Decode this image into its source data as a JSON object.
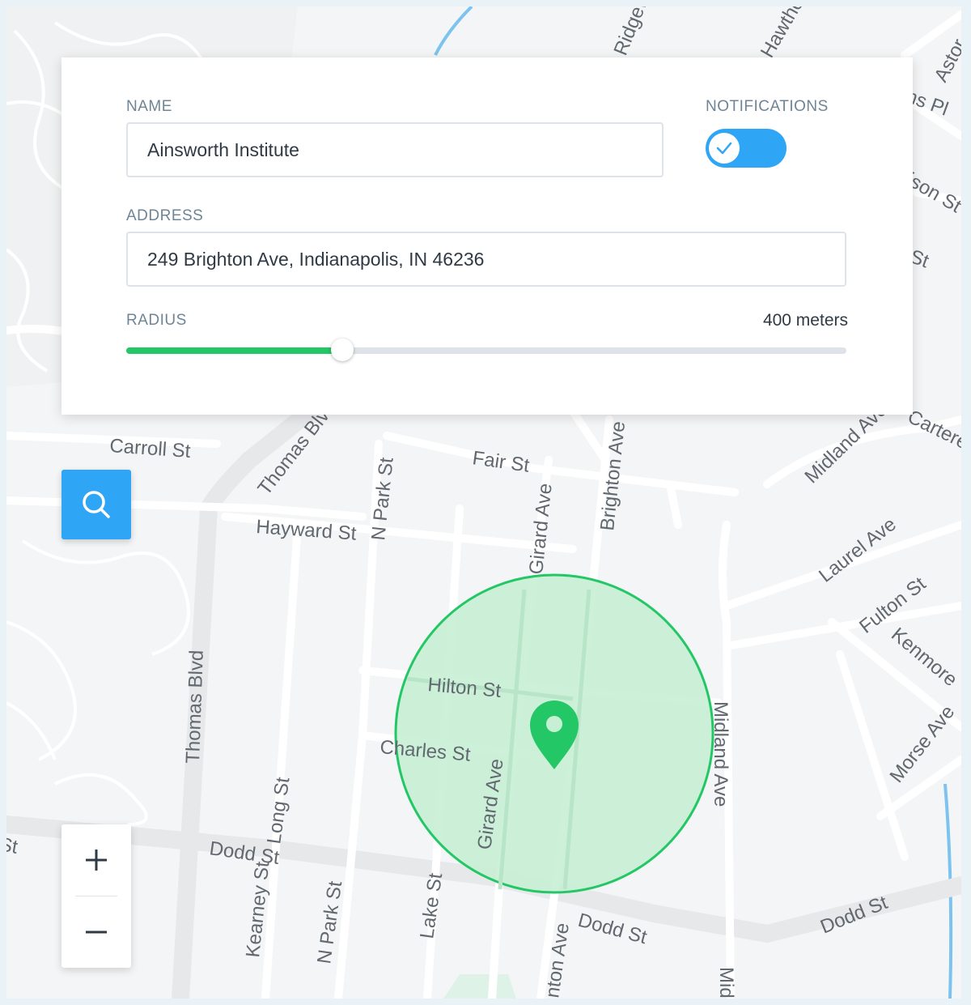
{
  "form": {
    "name_label": "NAME",
    "name_value": "Ainsworth Institute",
    "notifications_label": "NOTIFICATIONS",
    "notifications_on": true,
    "address_label": "ADDRESS",
    "address_value": "249 Brighton Ave, Indianapolis, IN 46236",
    "radius_label": "RADIUS",
    "radius_value": "400 meters",
    "radius_fraction": 0.3
  },
  "map": {
    "streets": {
      "ridgeway": "Ridgeway",
      "hawthorne": "Hawthorne",
      "astor": "Astor",
      "williams_pl": "Williams Pl",
      "madison_st": "Madison St",
      "st_fragment": "St",
      "carroll_st": "Carroll St",
      "thomas_blvd_upper": "Thomas Blvd",
      "n_park_st_upper": "N Park St",
      "fair_st": "Fair St",
      "girard_ave_upper": "Girard Ave",
      "brighton_ave": "Brighton Ave",
      "midland_ave_upper": "Midland Ave",
      "carteret": "Carteret",
      "hayward_st": "Hayward St",
      "laurel_ave": "Laurel Ave",
      "fulton_st": "Fulton St",
      "kenmore": "Kenmore",
      "morse_ave": "Morse Ave",
      "hilton_st": "Hilton St",
      "charles_st": "Charles St",
      "girard_ave_lower": "Girard Ave",
      "midland_ave_lower": "Midland Ave",
      "thomas_blvd_lower": "Thomas Blvd",
      "long_st": "Long St",
      "dodd_st_left": "Dodd St",
      "kearney_st": "Kearney St",
      "n_park_st_lower": "N Park St",
      "lake_st": "Lake St",
      "brighton_ave_bottom": "nton Ave",
      "dodd_st_mid": "Dodd St",
      "dodd_st_right": "Dodd St",
      "mid_fragment": "Mid",
      "edge_fragment": "St"
    }
  },
  "controls": {
    "search_icon": "search-icon",
    "zoom_in_icon": "plus-icon",
    "zoom_out_icon": "minus-icon"
  },
  "colors": {
    "accent_blue": "#2ea6f5",
    "radius_green": "#23c765"
  }
}
